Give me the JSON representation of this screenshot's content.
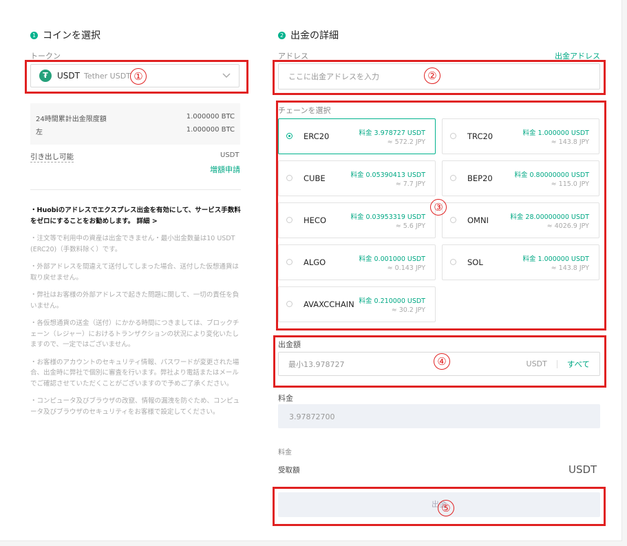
{
  "left": {
    "step_num": "1",
    "step_title": "コインを選択",
    "token_label": "トークン",
    "token": {
      "symbol": "USDT",
      "name": "Tether USDT",
      "logo": "₮"
    },
    "limit_label_1": "24時間累計出金限度額",
    "limit_value_1": "1.000000 BTC",
    "limit_label_2": "左",
    "limit_value_2": "1.000000 BTC",
    "withdrawable_label": "引き出し可能",
    "withdrawable_value": "USDT",
    "increase_link": "増額申請",
    "notes": [
      "・Huobiのアドレスでエクスプレス出金を有効にして、サービス手数料をゼロにすることをお勧めします。 詳細 >",
      "・注文等で利用中の資産は出金できません・最小出金数量は10 USDT (ERC20)（手数料除く）です。",
      "・外部アドレスを間違えて送付してしまった場合、送付した仮想通貨は取り戻せません。",
      "・弊社はお客様の外部アドレスで起きた問題に関して、一切の責任を負いません。",
      "・各仮想通貨の送金（送付）にかかる時間につきましては、ブロックチェーン（レジャー）におけるトランザクションの状況により変化いたしますので、一定ではございません。",
      "・お客様のアカウントのセキュリティ情報、パスワードが変更された場合、出金時に弊社で個別に審査を行います。弊社より電話またはメールでご確認させていただくことがございますので予めご了承ください。",
      "・コンピュータ及びブラウザの改竄、情報の漏洩を防ぐため、コンピュータ及びブラウザのセキュリティをお客様で設定してください。"
    ]
  },
  "right": {
    "step_num": "2",
    "step_title": "出金の詳細",
    "address_label": "アドレス",
    "address_link": "出金アドレス",
    "address_placeholder": "ここに出金アドレスを入力",
    "chain_label": "チェーンを選択",
    "chains": [
      {
        "name": "ERC20",
        "fee": "料金 3.978727 USDT",
        "jpy": "≈ 572.2 JPY",
        "selected": true
      },
      {
        "name": "TRC20",
        "fee": "料金 1.000000 USDT",
        "jpy": "≈ 143.8 JPY",
        "selected": false
      },
      {
        "name": "CUBE",
        "fee": "料金 0.05390413 USDT",
        "jpy": "≈ 7.7 JPY",
        "selected": false
      },
      {
        "name": "BEP20",
        "fee": "料金 0.80000000 USDT",
        "jpy": "≈ 115.0 JPY",
        "selected": false
      },
      {
        "name": "HECO",
        "fee": "料金 0.03953319 USDT",
        "jpy": "≈ 5.6 JPY",
        "selected": false
      },
      {
        "name": "OMNI",
        "fee": "料金 28.00000000 USDT",
        "jpy": "≈ 4026.9 JPY",
        "selected": false
      },
      {
        "name": "ALGO",
        "fee": "料金 0.001000 USDT",
        "jpy": "≈ 0.143 JPY",
        "selected": false
      },
      {
        "name": "SOL",
        "fee": "料金 1.000000 USDT",
        "jpy": "≈ 143.8 JPY",
        "selected": false
      },
      {
        "name": "AVAXCCHAIN",
        "fee": "料金 0.210000 USDT",
        "jpy": "≈ 30.2 JPY",
        "selected": false
      }
    ],
    "amount_label": "出金額",
    "amount_placeholder": "最小13.978727",
    "amount_unit": "USDT",
    "amount_all": "すべて",
    "fee_label": "料金",
    "fee_value": "3.97872700",
    "fee_label_2": "料金",
    "receive_label": "受取額",
    "receive_unit": "USDT",
    "submit_label": "出金"
  },
  "annotations": [
    "①",
    "②",
    "③",
    "④",
    "⑤"
  ],
  "colors": {
    "accent": "#00b28d",
    "highlight": "#e02020",
    "tether": "#26a17b"
  }
}
